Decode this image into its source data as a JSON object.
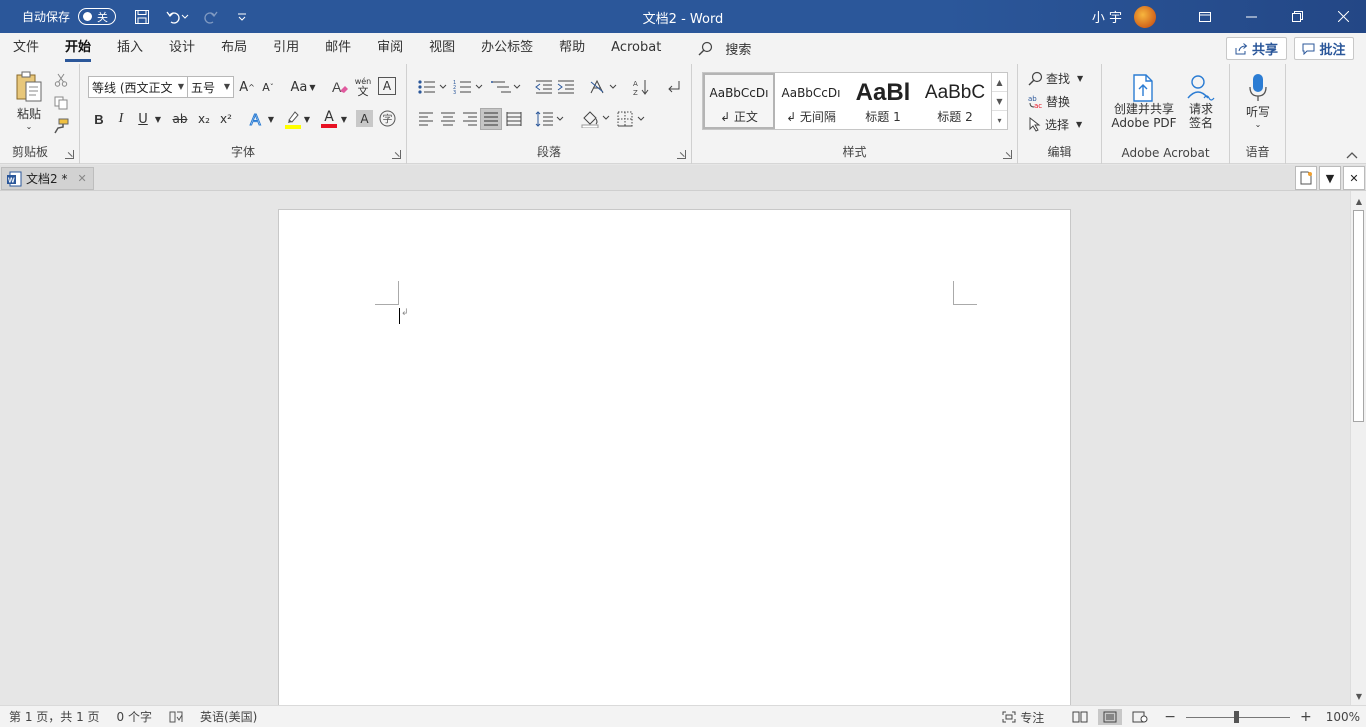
{
  "titlebar": {
    "autosave_label": "自动保存",
    "autosave_state": "关",
    "title": "文档2  -  Word",
    "user": "小 宇"
  },
  "menu": {
    "tabs": [
      "文件",
      "开始",
      "插入",
      "设计",
      "布局",
      "引用",
      "邮件",
      "审阅",
      "视图",
      "办公标签",
      "帮助",
      "Acrobat"
    ],
    "active_tab": "开始",
    "search": "搜索",
    "share": "共享",
    "comments": "批注"
  },
  "ribbon": {
    "clipboard": {
      "label": "剪贴板",
      "paste": "粘贴"
    },
    "font": {
      "label": "字体",
      "font_name": "等线 (西文正文",
      "font_size": "五号",
      "aa": "Aa",
      "bold": "B",
      "italic": "I",
      "underline": "U",
      "strike": "ab",
      "subscript": "x₂",
      "superscript": "x²",
      "font_color_glyph": "A",
      "wen": "wén",
      "wen_char": "文"
    },
    "paragraph": {
      "label": "段落"
    },
    "styles": {
      "label": "样式",
      "items": [
        {
          "sample": "AaBbCcDı",
          "name": "↲ 正文"
        },
        {
          "sample": "AaBbCcDı",
          "name": "↲ 无间隔"
        },
        {
          "sample": "AaBl",
          "name": "标题 1"
        },
        {
          "sample": "AaBbC",
          "name": "标题 2"
        }
      ]
    },
    "editing": {
      "label": "编辑",
      "find": "查找",
      "replace": "替换",
      "select": "选择"
    },
    "acrobat": {
      "label": "Adobe Acrobat",
      "create_line1": "创建并共享",
      "create_line2": "Adobe PDF",
      "sign_line1": "请求",
      "sign_line2": "签名"
    },
    "voice": {
      "label": "语音",
      "dictate": "听写"
    }
  },
  "doctab": {
    "name": "文档2 *"
  },
  "statusbar": {
    "page": "第 1 页，共 1 页",
    "words": "0 个字",
    "language": "英语(美国)",
    "focus": "专注",
    "zoom": "100%"
  },
  "colors": {
    "title_blue": "#2b579a",
    "highlight_yellow": "#ffff00",
    "font_red": "#e81123"
  }
}
